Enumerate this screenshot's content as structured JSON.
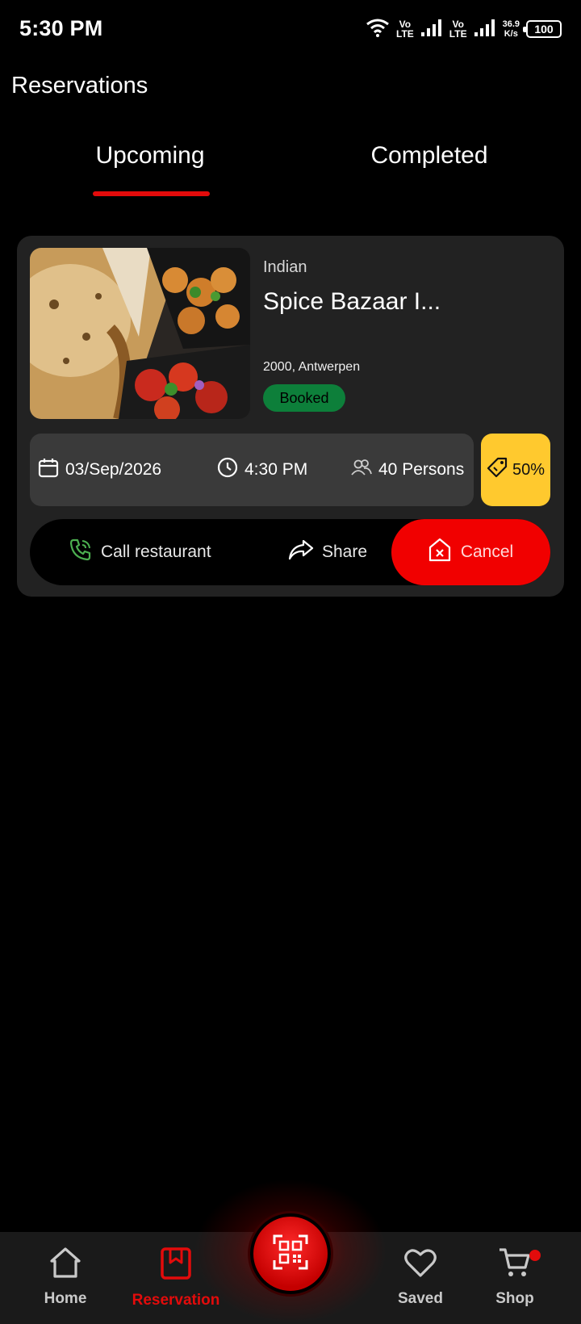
{
  "status_bar": {
    "time": "5:30 PM",
    "lte1_top": "Vo",
    "lte1_bottom": "LTE",
    "lte2_top": "Vo",
    "lte2_bottom": "LTE",
    "speed_value": "36.9",
    "speed_unit": "K/s",
    "battery": "100"
  },
  "header": {
    "title": "Reservations"
  },
  "tabs": [
    {
      "label": "Upcoming",
      "active": true
    },
    {
      "label": "Completed",
      "active": false
    }
  ],
  "reservation": {
    "cuisine": "Indian",
    "name": "Spice Bazaar I...",
    "address": "2000, Antwerpen",
    "status": "Booked",
    "date": "03/Sep/2026",
    "time": "4:30 PM",
    "persons": "40 Persons",
    "discount": "50%",
    "actions": {
      "call": "Call restaurant",
      "share": "Share",
      "cancel": "Cancel"
    }
  },
  "bottom_nav": {
    "items": [
      {
        "label": "Home",
        "icon": "home-icon",
        "active": false
      },
      {
        "label": "Reservation",
        "icon": "bookmark-icon",
        "active": true
      },
      {
        "label": "Saved",
        "icon": "heart-icon",
        "active": false
      },
      {
        "label": "Shop",
        "icon": "cart-icon",
        "active": false
      }
    ],
    "center_icon": "qr-scan-icon"
  },
  "colors": {
    "accent_red": "#e30b0b",
    "booked_green": "#0d7f3a",
    "discount_yellow": "#ffc92e",
    "card_bg": "#222222"
  }
}
